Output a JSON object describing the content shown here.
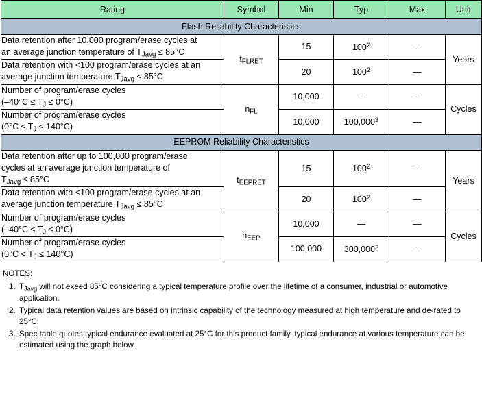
{
  "table": {
    "headers": [
      "Rating",
      "Symbol",
      "Min",
      "Typ",
      "Max",
      "Unit"
    ],
    "sections": [
      {
        "title": "Flash Reliability Characteristics",
        "rows": [
          {
            "rating_lines": [
              "Data retention after 10,000 program/erase cycles at",
              "an average junction temperature of T_Javg ≤ 85°C"
            ],
            "symbol": "t_FLRET",
            "min": "15",
            "typ": "100^2",
            "max": "—",
            "unit": "Years"
          },
          {
            "rating_lines": [
              "Data retention with <100 program/erase cycles at an",
              "average junction temperature T_Javg ≤ 85°C"
            ],
            "symbol": "",
            "min": "20",
            "typ": "100^2",
            "max": "—",
            "unit": ""
          },
          {
            "rating_lines": [
              "Number of program/erase cycles",
              "(–40°C ≤ T_J ≤ 0°C)"
            ],
            "symbol": "n_FL",
            "min": "10,000",
            "typ": "—",
            "max": "—",
            "unit": "Cycles"
          },
          {
            "rating_lines": [
              "Number of program/erase cycles",
              "(0°C ≤ T_J ≤ 140°C)"
            ],
            "symbol": "",
            "min": "10,000",
            "typ": "100,000^3",
            "max": "—",
            "unit": ""
          }
        ]
      },
      {
        "title": "EEPROM Reliability Characteristics",
        "rows": [
          {
            "rating_lines": [
              "Data retention after up to 100,000 program/erase",
              "cycles at an average junction temperature of",
              "T_Javg ≤ 85°C"
            ],
            "symbol": "t_EEPRET",
            "min": "15",
            "typ": "100^2",
            "max": "—",
            "unit": "Years"
          },
          {
            "rating_lines": [
              "Data retention with <100 program/erase cycles at an",
              "average junction temperature T_Javg ≤ 85°C"
            ],
            "symbol": "",
            "min": "20",
            "typ": "100^2",
            "max": "—",
            "unit": ""
          },
          {
            "rating_lines": [
              "Number of program/erase cycles",
              "(–40°C ≤ T_J ≤ 0°C)"
            ],
            "symbol": "n_EEP",
            "min": "10,000",
            "typ": "—",
            "max": "—",
            "unit": "Cycles"
          },
          {
            "rating_lines": [
              "Number of program/erase cycles",
              "(0°C < T_J ≤ 140°C)"
            ],
            "symbol": "",
            "min": "100,000",
            "typ": "300,000^3",
            "max": "—",
            "unit": ""
          }
        ]
      }
    ]
  },
  "notes": {
    "title": "NOTES:",
    "items": [
      {
        "num": "1.",
        "text": "T_Javg will not exeed 85°C considering a typical temperature profile over the lifetime of a consumer, industrial or automotive application."
      },
      {
        "num": "2.",
        "text": "Typical data retention values are based on intrinsic capability of the technology measured at high temperature and de-rated to 25°C."
      },
      {
        "num": "3.",
        "text": "Spec table quotes typical endurance evaluated at 25°C for this product family, typical endurance at various temperature can be estimated using the graph below."
      }
    ]
  },
  "colors": {
    "header_green": "#99E8B4",
    "section_band": "#AEC0D2",
    "border": "#000000",
    "text": "#000000"
  }
}
